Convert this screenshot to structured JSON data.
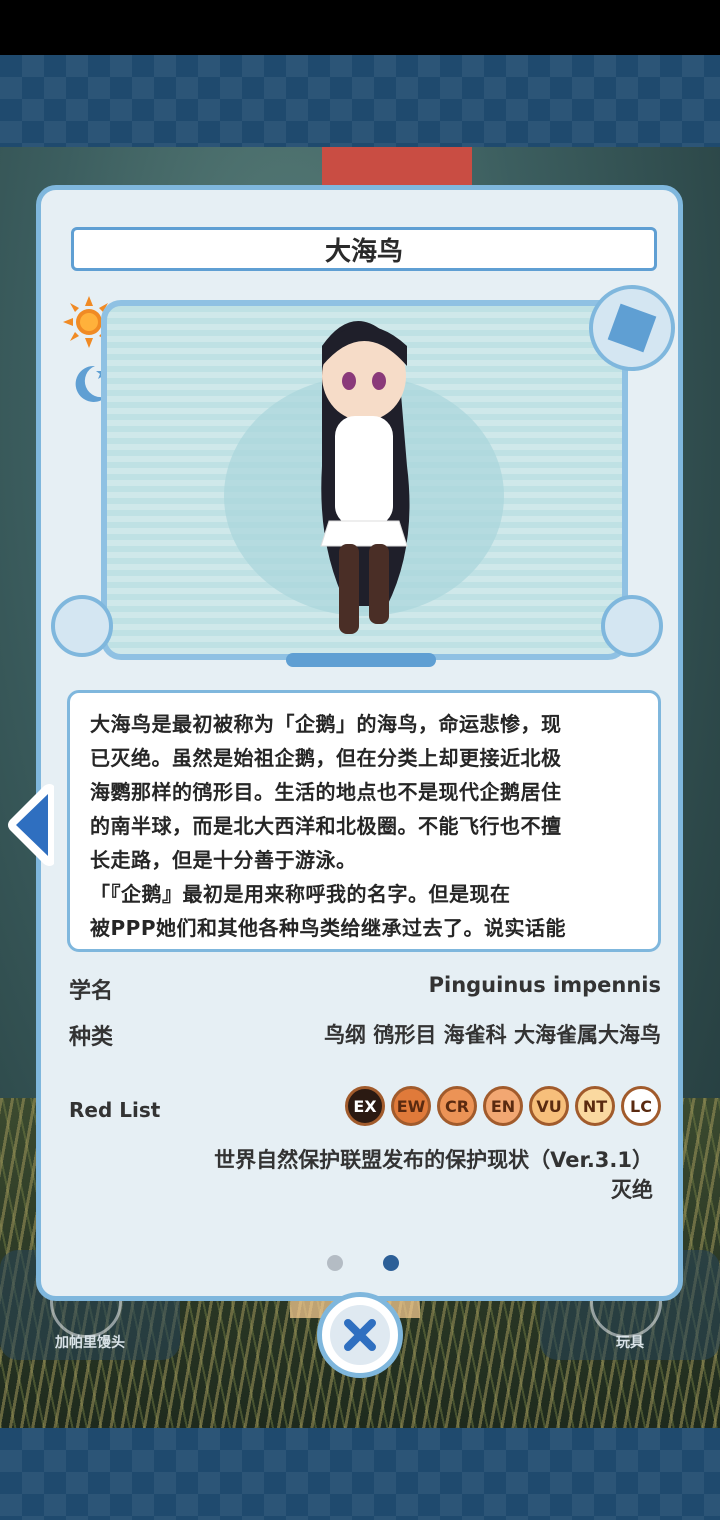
{
  "colors": {
    "panel_border": "#7fb7dd",
    "panel_bg": "#e6eff4",
    "accent_blue": "#5f9fd3",
    "active_dot": "#2c5f97",
    "title_text": "#2a2a2a"
  },
  "background": {
    "left_button_label": "加帕里馒头",
    "right_button_label": "玩具"
  },
  "card": {
    "title": "大海鸟",
    "description_lines": [
      "大海鸟是最初被称为「企鹅」的海鸟，命运悲惨，现",
      "已灭绝。虽然是始祖企鹅，但在分类上却更接近北极",
      "海鹦那样的鸻形目。生活的地点也不是现代企鹅居住",
      "的南半球，而是北大西洋和北极圈。不能飞行也不擅",
      "长走路，但是十分善于游泳。",
      "「『企鹅』最初是用来称呼我的名字。但是现在",
      "被PPP她们和其他各种鸟类给继承过去了。说实话能"
    ],
    "scientific_name_label": "学名",
    "scientific_name": "Pinguinus  impennis",
    "classification_label": "种类",
    "classification": "鸟纲  鸻形目  海雀科  大海雀属大海鸟",
    "red_list_label": "Red  List",
    "red_list_badges": [
      {
        "code": "EX",
        "fill": "#2b1a12",
        "text": "#ffffff",
        "selected": true
      },
      {
        "code": "EW",
        "fill": "#e07a3a",
        "text": "#5a2a10",
        "selected": false
      },
      {
        "code": "CR",
        "fill": "#ec9356",
        "text": "#5a2a10",
        "selected": false
      },
      {
        "code": "EN",
        "fill": "#f2a772",
        "text": "#5a2a10",
        "selected": false
      },
      {
        "code": "VU",
        "fill": "#f7bf7b",
        "text": "#5a2a10",
        "selected": false
      },
      {
        "code": "NT",
        "fill": "#fad9a0",
        "text": "#5a2a10",
        "selected": false
      },
      {
        "code": "LC",
        "fill": "#ffffff",
        "text": "#5a2a10",
        "selected": false
      }
    ],
    "status_caption": "世界自然保护联盟发布的保护现状（Ver.3.1）",
    "status_value": "灭绝",
    "page_indicator": {
      "total": 2,
      "active": 2
    },
    "time_icons": [
      "sun-icon",
      "moon-icon"
    ]
  },
  "controls": {
    "close_icon": "close-icon",
    "prev_icon": "arrow-left-icon"
  }
}
